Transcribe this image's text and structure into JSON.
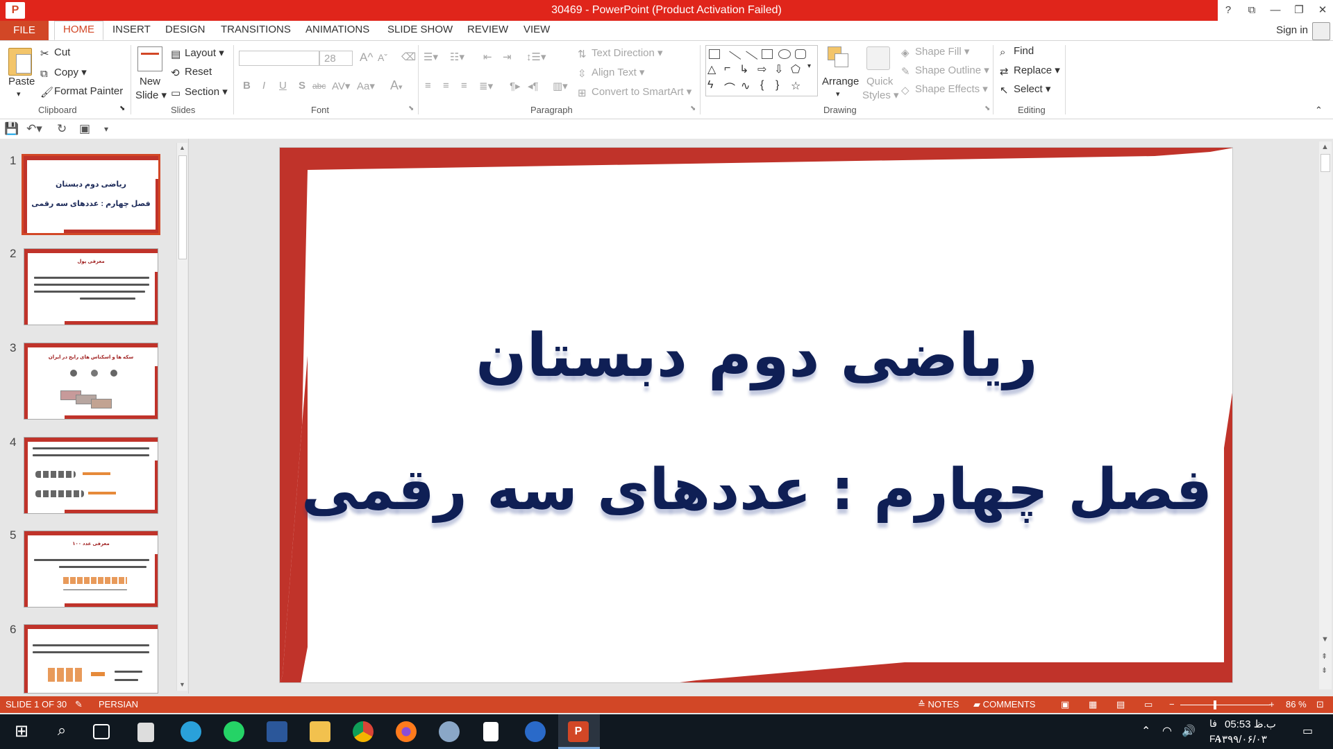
{
  "window": {
    "title": "30469 -  PowerPoint (Product Activation Failed)",
    "help": "?",
    "ribbon_display": "⧉",
    "minimize": "—",
    "restore": "❐",
    "close": "✕"
  },
  "tabs": {
    "file": "FILE",
    "home": "HOME",
    "insert": "INSERT",
    "design": "DESIGN",
    "transitions": "TRANSITIONS",
    "animations": "ANIMATIONS",
    "slide_show": "SLIDE SHOW",
    "review": "REVIEW",
    "view": "VIEW",
    "sign_in": "Sign in"
  },
  "ribbon": {
    "clipboard": {
      "paste": "Paste",
      "cut": "Cut",
      "copy": "Copy",
      "format_painter": "Format Painter",
      "label": "Clipboard"
    },
    "slides": {
      "new_slide_1": "New",
      "new_slide_2": "Slide",
      "layout": "Layout",
      "reset": "Reset",
      "section": "Section",
      "label": "Slides"
    },
    "font": {
      "size": "28",
      "bold": "B",
      "italic": "I",
      "underline": "U",
      "shadow": "S",
      "strike": "abc",
      "spacing": "AV",
      "case": "Aa",
      "color": "A",
      "grow": "A",
      "shrink": "A",
      "label": "Font"
    },
    "paragraph": {
      "text_direction": "Text Direction",
      "align_text": "Align Text",
      "convert_smartart": "Convert to SmartArt",
      "label": "Paragraph"
    },
    "drawing": {
      "arrange": "Arrange",
      "quick_styles_1": "Quick",
      "quick_styles_2": "Styles",
      "shape_fill": "Shape Fill",
      "shape_outline": "Shape Outline",
      "shape_effects": "Shape Effects",
      "label": "Drawing"
    },
    "editing": {
      "find": "Find",
      "replace": "Replace",
      "select": "Select",
      "label": "Editing"
    }
  },
  "thumbnails": [
    {
      "num": "1",
      "title": "ریاضی دوم دبستان",
      "sub": "فصل چهارم : عددهای سه رقمی"
    },
    {
      "num": "2",
      "title": "معرفی پول"
    },
    {
      "num": "3",
      "title": "سکه ها و اسکناس های رایج در ایران"
    },
    {
      "num": "4"
    },
    {
      "num": "5",
      "title": "معرفی عدد ۱۰۰"
    },
    {
      "num": "6"
    }
  ],
  "slide": {
    "title": "ریاضی دوم دبستان",
    "subtitle": "فصل چهارم : عددهای سه رقمی"
  },
  "status": {
    "slide_info": "SLIDE 1 OF 30",
    "language": "PERSIAN",
    "notes": "NOTES",
    "comments": "COMMENTS",
    "zoom": "86 %",
    "zoom_minus": "−",
    "zoom_plus": "+"
  },
  "taskbar": {
    "time": "05:53 ب.ظ",
    "date": "۱۳۹۹/۰۶/۰۳",
    "lang_top": "فا",
    "lang_bottom": "FA"
  },
  "colors": {
    "accent": "#d24726",
    "titlebar": "#e0251b",
    "slide_frame": "#c0332a",
    "slide_text": "#0f1f55"
  }
}
